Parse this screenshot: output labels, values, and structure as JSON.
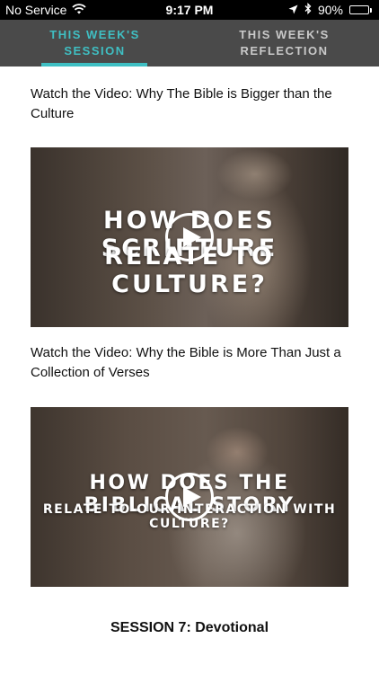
{
  "status_bar": {
    "carrier": "No Service",
    "time": "9:17 PM",
    "battery": "90%",
    "battery_level": 0.9
  },
  "tabs": [
    {
      "line1": "THIS WEEK'S",
      "line2": "SESSION",
      "active": true
    },
    {
      "line1": "THIS WEEK'S",
      "line2": "REFLECTION",
      "active": false
    }
  ],
  "videos": [
    {
      "title": "Watch the Video: Why The Bible is Bigger than the Culture",
      "overlay_line1": "HOW DOES SCRIPTURE",
      "overlay_line2": "RELATE TO CULTURE?"
    },
    {
      "title": "Watch the Video: Why the Bible is More Than Just a Collection of Verses",
      "overlay_line1": "HOW DOES THE BIBLICAL STORY",
      "overlay_line2": "RELATE TO OUR INTERACTION WITH CULTURE?"
    }
  ],
  "section_heading": "SESSION 7: Devotional",
  "colors": {
    "accent": "#3fbfc3",
    "tab_bar": "#4a4a4a"
  }
}
